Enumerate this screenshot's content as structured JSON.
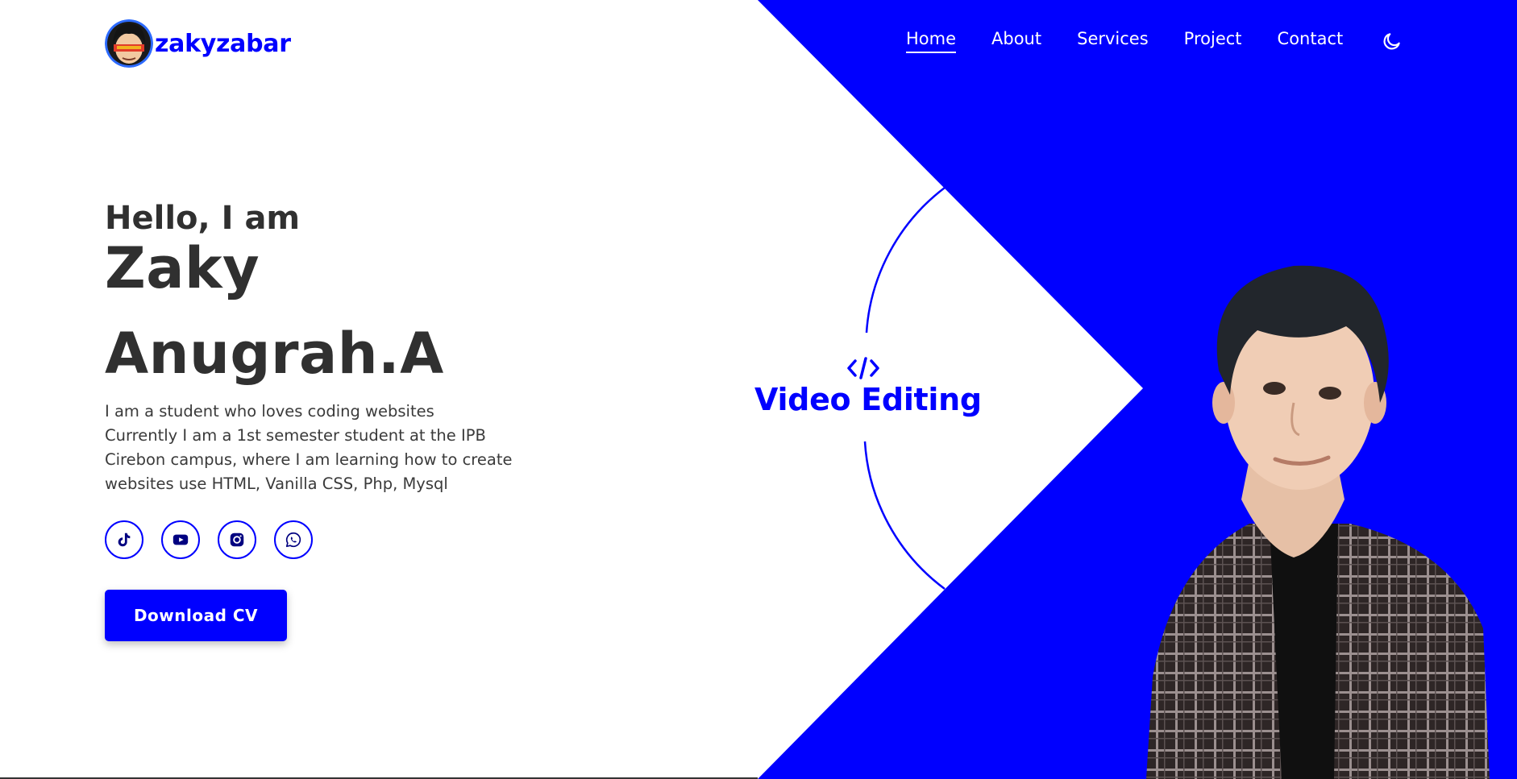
{
  "window": {
    "title": "zakyzabar"
  },
  "header": {
    "logo_text": "zakyzabar",
    "nav": [
      {
        "label": "Home",
        "active": true
      },
      {
        "label": "About"
      },
      {
        "label": "Services"
      },
      {
        "label": "Project"
      },
      {
        "label": "Contact"
      }
    ],
    "theme_toggle_icon": "moon-icon"
  },
  "hero": {
    "greeting": "Hello, I am",
    "name_line_1": "Zaky",
    "name_line_2": "Anugrah.A",
    "bio_lines": [
      "I am a student who loves coding websites",
      "Currently I am a 1st semester student at the IPB",
      "Cirebon campus, where I am learning how to create",
      "websites use HTML, Vanilla CSS, Php, Mysql"
    ],
    "socials": [
      {
        "icon": "tiktok-icon"
      },
      {
        "icon": "youtube-icon"
      },
      {
        "icon": "instagram-icon"
      },
      {
        "icon": "whatsapp-icon"
      }
    ],
    "cv_button": "Download CV",
    "skill_icon": "code-icon",
    "skill_text": "Video Editing"
  },
  "colors": {
    "accent": "#0000ff",
    "text_dark": "#303030",
    "background": "#ffffff"
  }
}
